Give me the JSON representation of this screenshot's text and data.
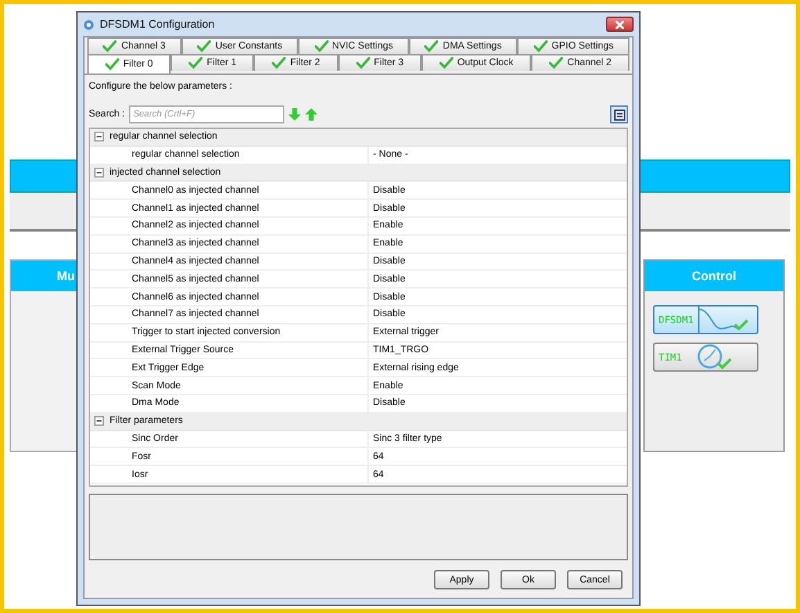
{
  "window": {
    "title": "DFSDM1 Configuration"
  },
  "background": {
    "left_panel": {
      "title": "Mu"
    },
    "control_panel": {
      "title": "Control",
      "buttons": [
        {
          "label": "DFSDM1",
          "kind": "filter",
          "selected": true
        },
        {
          "label": "TIM1",
          "kind": "clock",
          "selected": false
        }
      ]
    }
  },
  "tabs": [
    [
      {
        "label": "Channel 3",
        "selected": false
      },
      {
        "label": "User Constants",
        "selected": false
      },
      {
        "label": "NVIC Settings",
        "selected": false
      },
      {
        "label": "DMA Settings",
        "selected": false
      },
      {
        "label": "GPIO Settings",
        "selected": false
      }
    ],
    [
      {
        "label": "Filter 0",
        "selected": true
      },
      {
        "label": "Filter 1",
        "selected": false
      },
      {
        "label": "Filter 2",
        "selected": false
      },
      {
        "label": "Filter 3",
        "selected": false
      },
      {
        "label": "Output Clock",
        "selected": false
      },
      {
        "label": "Channel 2",
        "selected": false
      }
    ]
  ],
  "intro": "Configure the below parameters :",
  "search": {
    "label": "Search :",
    "placeholder": "Search (Crtl+F)"
  },
  "groups": [
    {
      "title": "regular channel selection",
      "expanded": true,
      "children": [
        {
          "name": "regular channel selection",
          "value": "- None -"
        }
      ]
    },
    {
      "title": "injected channel selection",
      "expanded": true,
      "children": [
        {
          "name": "Channel0 as injected channel",
          "value": "Disable"
        },
        {
          "name": "Channel1 as injected channel",
          "value": "Disable"
        },
        {
          "name": "Channel2 as injected channel",
          "value": "Enable"
        },
        {
          "name": "Channel3 as injected channel",
          "value": "Enable"
        },
        {
          "name": "Channel4 as injected channel",
          "value": "Disable"
        },
        {
          "name": "Channel5 as injected channel",
          "value": "Disable"
        },
        {
          "name": "Channel6 as injected channel",
          "value": "Disable"
        },
        {
          "name": "Channel7 as injected channel",
          "value": "Disable"
        },
        {
          "name": "Trigger to start injected conversion",
          "value": "External trigger"
        },
        {
          "name": "External Trigger Source",
          "value": "TIM1_TRGO"
        },
        {
          "name": "Ext Trigger Edge",
          "value": "External rising edge"
        },
        {
          "name": "Scan Mode",
          "value": "Enable"
        },
        {
          "name": "Dma Mode",
          "value": "Disable"
        }
      ]
    },
    {
      "title": "Filter parameters",
      "expanded": true,
      "children": [
        {
          "name": "Sinc Order",
          "value": "Sinc 3 filter type"
        },
        {
          "name": "Fosr",
          "value": "64"
        },
        {
          "name": "Iosr",
          "value": "64"
        }
      ]
    }
  ],
  "buttons": [
    "Apply",
    "Ok",
    "Cancel"
  ]
}
